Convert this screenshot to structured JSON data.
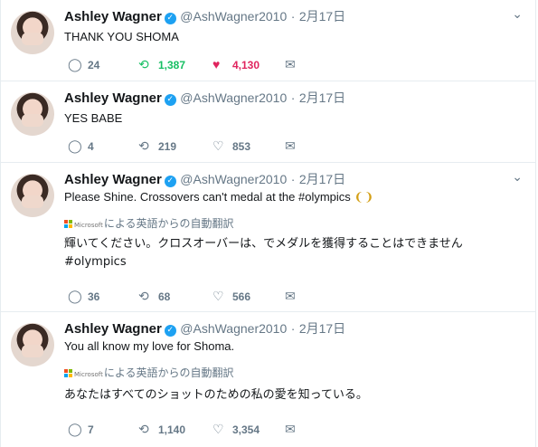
{
  "tweets": [
    {
      "name": "Ashley Wagner",
      "handle": "@AshWagner2010",
      "date": "2月17日",
      "text": "THANK YOU SHOMA",
      "replies": "24",
      "retweets": "1,387",
      "likes": "4,130",
      "retweeted": true,
      "liked": true
    },
    {
      "name": "Ashley Wagner",
      "handle": "@AshWagner2010",
      "date": "2月17日",
      "text": "YES BABE",
      "replies": "4",
      "retweets": "219",
      "likes": "853",
      "retweeted": false,
      "liked": false
    },
    {
      "name": "Ashley Wagner",
      "handle": "@AshWagner2010",
      "date": "2月17日",
      "text": "Please Shine. Crossovers can't medal at the #olympics",
      "translate_brand": "Microsoft",
      "translate_label": "による英語からの自動翻訳",
      "translation_line1": "輝いてください。クロスオーバーは、でメダルを獲得することはできません",
      "translation_line2": "#olympics",
      "replies": "36",
      "retweets": "68",
      "likes": "566",
      "retweeted": false,
      "liked": false
    },
    {
      "name": "Ashley Wagner",
      "handle": "@AshWagner2010",
      "date": "2月17日",
      "text": "You all know my love for Shoma.",
      "translate_brand": "Microsoft",
      "translate_label": "による英語からの自動翻訳",
      "translation_line1": "あなたはすべてのショットのための私の愛を知っている。",
      "replies": "7",
      "retweets": "1,140",
      "likes": "3,354",
      "retweeted": false,
      "liked": false
    }
  ],
  "icons": {
    "reply": "reply-icon",
    "retweet": "retweet-icon",
    "like": "heart-icon",
    "dm": "envelope-icon",
    "verified": "verified-badge-icon",
    "menu": "chevron-down-icon"
  },
  "colors": {
    "retweet_active": "#17bf63",
    "like_active": "#e0245e",
    "muted": "#657786",
    "verified": "#1da1f2"
  }
}
